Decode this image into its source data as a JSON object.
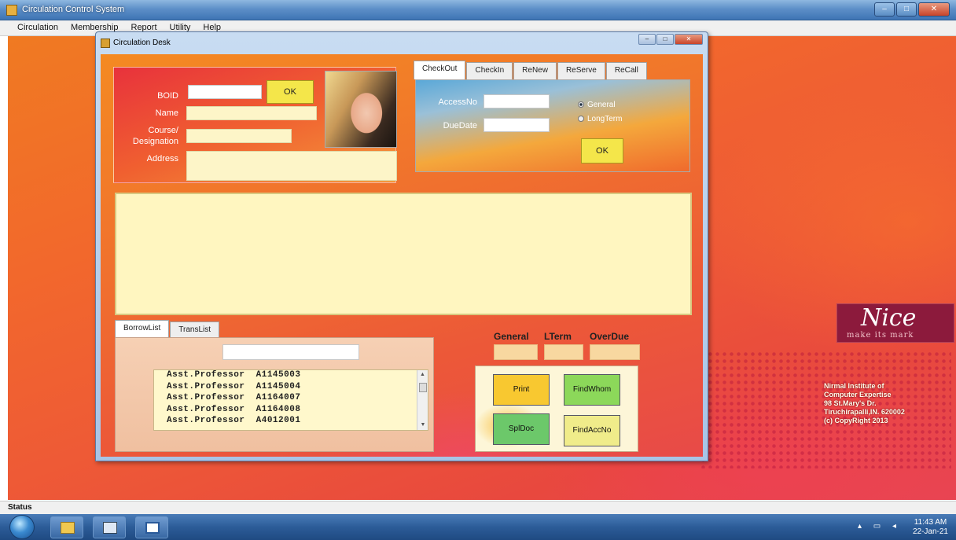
{
  "window": {
    "title": "Circulation Control System"
  },
  "menu": [
    "Circulation",
    "Membership",
    "Report",
    "Utility",
    "Help"
  ],
  "child": {
    "title": "Circulation Desk",
    "bio": {
      "boid_label": "BOID",
      "ok_label": "OK",
      "name_label": "Name",
      "course_label_1": "Course/",
      "course_label_2": "Designation",
      "address_label": "Address"
    },
    "tabs_top": [
      "CheckOut",
      "CheckIn",
      "ReNew",
      "ReServe",
      "ReCall"
    ],
    "checkout": {
      "accessno_label": "AccessNo",
      "duedate_label": "DueDate",
      "radio_general": "General",
      "radio_longterm": "LongTerm",
      "ok_label": "OK"
    },
    "tabs_bottom": [
      "BorrowList",
      "TransList"
    ],
    "borrow_list": [
      "Asst.Professor  A1145003",
      "Asst.Professor  A1145004",
      "Asst.Professor  A1164007",
      "Asst.Professor  A1164008",
      "Asst.Professor  A4012001"
    ],
    "counts": {
      "general_label": "General",
      "lterm_label": "LTerm",
      "overdue_label": "OverDue"
    },
    "actions": {
      "print": "Print",
      "findwhom": "FindWhom",
      "spldoc": "SplDoc",
      "findaccno": "FindAccNo"
    },
    "colors": {
      "ok_button": "#f4e64a",
      "green_button": "#8cd85a",
      "print_button": "#f8c830"
    }
  },
  "desktop": {
    "logo_word": "Nice",
    "logo_tagline": "make its mark",
    "institute": [
      "Nirmal Institute of",
      "Computer Expertise",
      "98 St.Mary's Dr.",
      "Tiruchirapalli,IN. 620002",
      "(c) CopyRight 2013"
    ]
  },
  "status": {
    "label": "Status"
  },
  "tray": {
    "time": "11:43 AM",
    "date": "22-Jan-21"
  }
}
